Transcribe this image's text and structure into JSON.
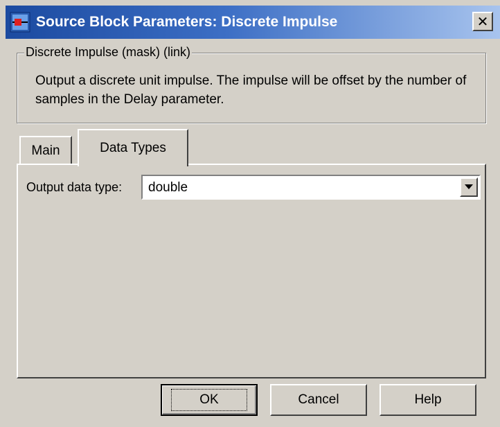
{
  "window": {
    "title": "Source Block Parameters: Discrete  Impulse",
    "close_label": "✕"
  },
  "group": {
    "legend": "Discrete Impulse  (mask) (link)",
    "description": "Output a discrete unit impulse.  The impulse will be offset by the number of samples in the Delay parameter."
  },
  "tabs": [
    {
      "label": "Main",
      "active": false
    },
    {
      "label": "Data Types",
      "active": true
    }
  ],
  "panel": {
    "output_data_type_label": "Output data type:",
    "output_data_type_value": "double"
  },
  "buttons": {
    "ok": "OK",
    "cancel": "Cancel",
    "help": "Help"
  },
  "colors": {
    "titlebar_start": "#1b4aa0",
    "titlebar_end": "#a8c4ee",
    "face": "#d4d0c8"
  },
  "icons": {
    "window_icon": "simulink-block-icon",
    "dropdown": "dropdown-arrow-icon"
  }
}
